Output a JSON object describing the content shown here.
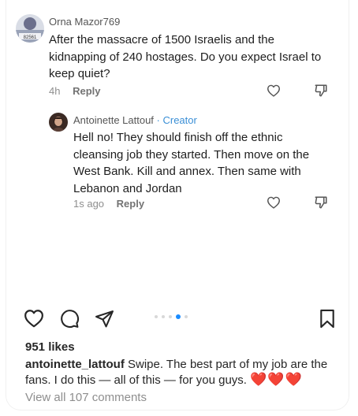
{
  "comments": [
    {
      "username": "Orna Mazor769",
      "text": "After the massacre of 1500 Israelis and the kidnapping of 240 hostages. Do you expect Israel to keep quiet?",
      "time": "4h",
      "reply_label": "Reply",
      "avatar_label": "82561"
    },
    {
      "username": "Antoinette Lattouf",
      "badge": "· Creator",
      "text": "Hell no! They should finish off the ethnic cleansing job they started. Then move on the West Bank. Kill and annex. Then same with Lebanon and Jordan",
      "time": "1s ago",
      "reply_label": "Reply"
    }
  ],
  "post": {
    "likes": "951 likes",
    "caption_user": "antoinette_lattouf",
    "caption_text": " Swipe. The best part of my job are the fans. I do this — all of this — for you guys. ",
    "caption_hearts": "❤️❤️❤️",
    "view_comments": "View all 107 comments",
    "carousel": {
      "count": 5,
      "active_index": 3
    }
  },
  "icons": {
    "comment_like": "heart-outline-icon",
    "comment_dislike": "thumbs-down-icon",
    "post_like": "heart-outline-icon",
    "post_comment": "comment-bubble-icon",
    "post_share": "paper-plane-icon",
    "post_save": "bookmark-icon"
  },
  "colors": {
    "creator_badge": "#3a8fd6",
    "carousel_active": "#1a8cff",
    "hearts": "#e0302a"
  }
}
